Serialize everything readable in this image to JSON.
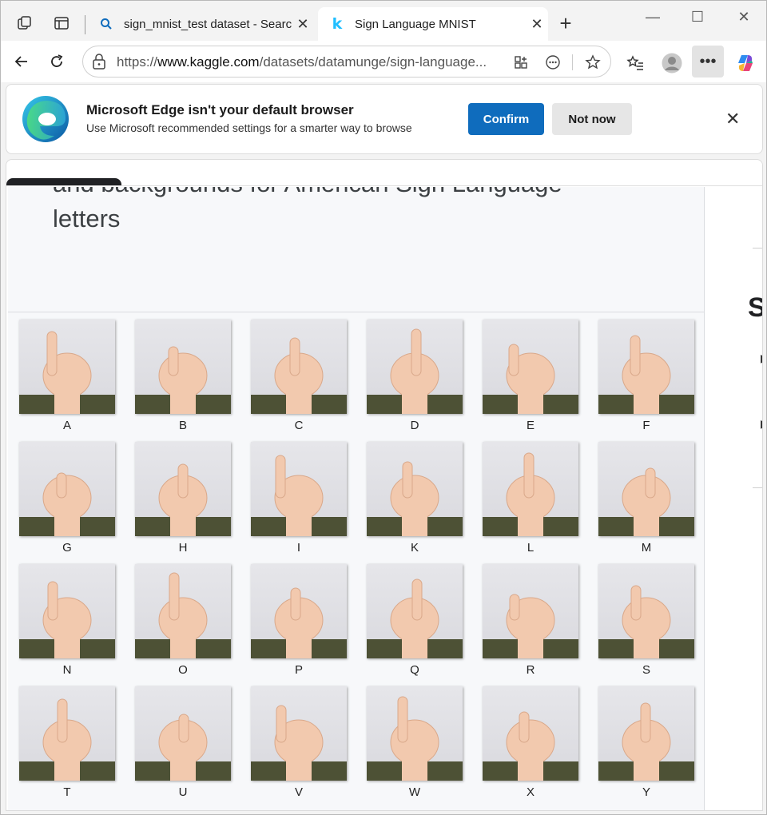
{
  "browser": {
    "tabs": [
      {
        "title": "sign_mnist_test dataset - Search",
        "favicon": "search-icon",
        "active": false
      },
      {
        "title": "Sign Language MNIST",
        "favicon": "kaggle-k-icon",
        "active": true
      }
    ],
    "new_tab_label": "+",
    "url_prefix": "https://",
    "url_host": "www.kaggle.com",
    "url_path": "/datasets/datamunge/sign-language...",
    "window_controls": [
      "minimize",
      "maximize",
      "close"
    ]
  },
  "banner": {
    "title": "Microsoft Edge isn't your default browser",
    "subtitle": "Use Microsoft recommended settings for a smarter way to browse",
    "confirm_label": "Confirm",
    "not_now_label": "Not now"
  },
  "page": {
    "subtitle_line1": "and backgrounds for American Sign Language",
    "subtitle_line2": "letters",
    "side_heading": "S"
  },
  "signs": {
    "letters": [
      "A",
      "B",
      "C",
      "D",
      "E",
      "F",
      "G",
      "H",
      "I",
      "K",
      "L",
      "M",
      "N",
      "O",
      "P",
      "Q",
      "R",
      "S",
      "T",
      "U",
      "V",
      "W",
      "X",
      "Y"
    ]
  },
  "colors": {
    "accent": "#0f6cbd",
    "sleeve": "#4d5135",
    "skin": "#f2c9ae"
  }
}
